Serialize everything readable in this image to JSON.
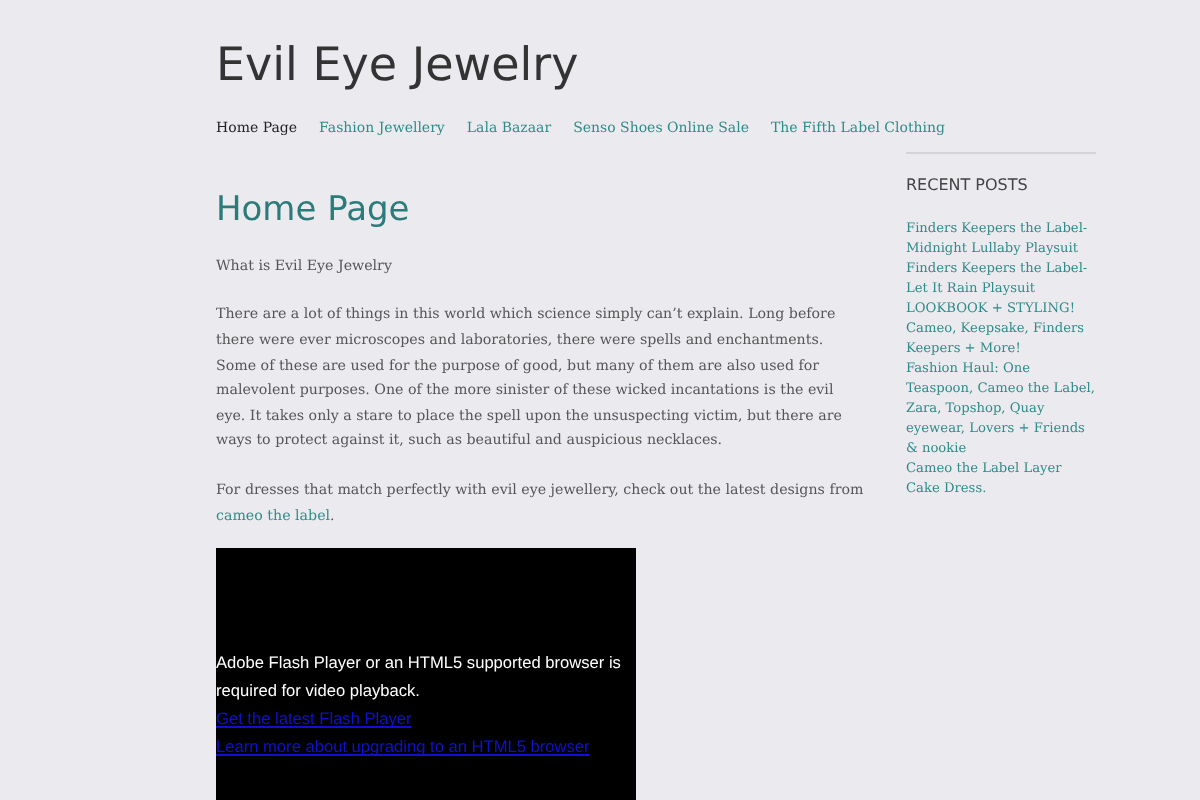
{
  "site_title": "Evil Eye Jewelry",
  "nav": [
    {
      "label": "Home Page",
      "selected": true
    },
    {
      "label": "Fashion Jewellery",
      "selected": false
    },
    {
      "label": "Lala Bazaar",
      "selected": false
    },
    {
      "label": "Senso Shoes Online Sale",
      "selected": false
    },
    {
      "label": "The Fifth Label Clothing",
      "selected": false
    }
  ],
  "page_title": "Home Page",
  "intro": "What is Evil Eye Jewelry",
  "paragraph": "There are a lot of things in this world which science simply can’t explain. Long before there were ever microscopes and laboratories, there were spells and enchantments. Some of these are used for the purpose of good, but many of them are also used for malevolent purposes. One of the more sinister of these wicked incantations is the evil eye. It takes only a stare to place the spell upon the unsuspecting victim, but there are ways to protect against it, such as beautiful and auspicious necklaces.",
  "cta": {
    "text": "For dresses that match perfectly with evil eye jewellery, check out the latest designs from",
    "link": "cameo the label",
    "after": "."
  },
  "video": {
    "message": "Adobe Flash Player or an HTML5 supported browser is required for video playback.",
    "links": [
      "Get the latest Flash Player",
      "Learn more about upgrading to an HTML5 browser"
    ]
  },
  "sidebar": {
    "heading": "RECENT POSTS",
    "posts": [
      "Finders Keepers the Label-Midnight Lullaby Playsuit",
      "Finders Keepers the Label-Let It Rain Playsuit",
      "LOOKBOOK + STYLING! Cameo, Keepsake, Finders Keepers + More!",
      "Fashion Haul: One Teaspoon, Cameo the Label, Zara, Topshop, Quay eyewear, Lovers + Friends & nookie",
      "Cameo the Label Layer Cake Dress."
    ]
  }
}
